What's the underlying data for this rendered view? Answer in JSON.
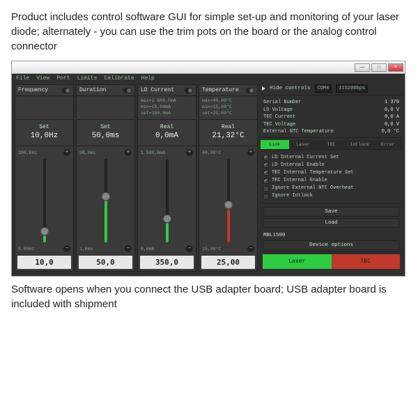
{
  "intro": "Product includes control software GUI for simple set-up and monitoring of your laser diode; alternately - you can use the trim pots on the board or the analog control connector",
  "outro": "Software opens when you connect the USB adapter board; USB adapter board is included with shipment",
  "menu": [
    "File",
    "View",
    "Port",
    "Limits",
    "Calibrate",
    "Help"
  ],
  "hide_controls_label": "Hide controls",
  "port": "COM4",
  "baud": "115200bps",
  "channels": [
    {
      "title": "Frequency",
      "info": "",
      "big_lbl": "Set",
      "big_val": "10,0Hz",
      "max": "100,0Hz",
      "min": "0,00Hz",
      "fill_pct": 8,
      "thumb_pct": 8,
      "fill_color": "green",
      "box": "10,0"
    },
    {
      "title": "Duration",
      "info": "",
      "big_lbl": "Set",
      "big_val": "50,0ms",
      "max": "98,0ms",
      "min": "1,0ms",
      "fill_pct": 50,
      "thumb_pct": 50,
      "fill_color": "green",
      "box": "50,0"
    },
    {
      "title": "LD Current",
      "info": "max=1 500,0mA\nmin=15,00mA\nset=350,0mA",
      "big_lbl": "Real",
      "big_val": "0,0mA",
      "max": "1 500,0mA",
      "min": "0,0mA",
      "fill_pct": 23,
      "thumb_pct": 23,
      "fill_color": "green",
      "box": "350,0"
    },
    {
      "title": "Temperature",
      "info": "max=40,00°C\nmin=15,00°C\nset=25,00°C",
      "big_lbl": "Real",
      "big_val": "21,32°C",
      "max": "40,00°C",
      "min": "15,00°C",
      "fill_pct": 40,
      "thumb_pct": 40,
      "fill_color": "red",
      "box": "25,00"
    }
  ],
  "stats": [
    {
      "label": "Serial Number",
      "value": "1 379",
      "unit": ""
    },
    {
      "label": "LD Voltage",
      "value": "0,0",
      "unit": "V"
    },
    {
      "label": "TEC Current",
      "value": "0,0",
      "unit": "A"
    },
    {
      "label": "TEC Voltage",
      "value": "0,0",
      "unit": "V"
    },
    {
      "label": "External NTC Temperature",
      "value": "0,0",
      "unit": "°C"
    }
  ],
  "status_lights": [
    {
      "label": "Link",
      "on": true
    },
    {
      "label": "Laser",
      "on": false
    },
    {
      "label": "TEC",
      "on": false
    },
    {
      "label": "Intlock",
      "on": false
    },
    {
      "label": "Error",
      "on": false
    }
  ],
  "checks": [
    {
      "label": "LD Internal Current Set",
      "on": true
    },
    {
      "label": "LD Internal Enable",
      "on": true
    },
    {
      "label": "TEC Internal Temperature Set",
      "on": true
    },
    {
      "label": "TEC Internal Enable",
      "on": true
    },
    {
      "label": "Ignore External NTC Overheat",
      "on": false
    },
    {
      "label": "Ignore Intlock",
      "on": false
    }
  ],
  "btn_save": "Save",
  "btn_load": "Load",
  "device_name": "MBL1500",
  "btn_device_options": "Device options",
  "btn_laser": "Laser",
  "btn_tec": "TEC"
}
